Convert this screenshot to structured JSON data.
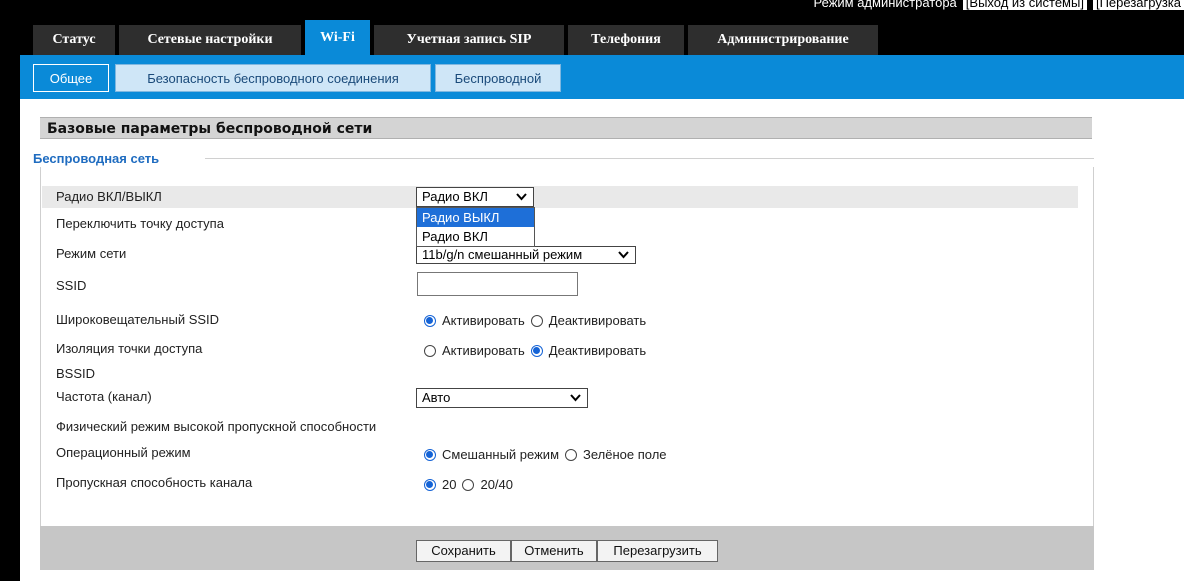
{
  "topbar": {
    "mode": "Режим администратора",
    "logout": "[Выход из системы]",
    "reboot": "[Перезагрузка"
  },
  "tabs": [
    "Статус",
    "Сетевые настройки",
    "Wi-Fi",
    "Учетная запись SIP",
    "Телефония",
    "Администрирование"
  ],
  "active_tab": "Wi-Fi",
  "subtabs": [
    "Общее",
    "Безопасность беспроводного соединения",
    "Беспроводной"
  ],
  "active_subtab": "Общее",
  "section_title": "Базовые параметры беспроводной сети",
  "legend": "Беспроводная сеть",
  "fields": {
    "radio": {
      "label": "Радио ВКЛ/ВЫКЛ",
      "value": "Радио ВКЛ",
      "options": [
        "Радио ВЫКЛ",
        "Радио ВКЛ"
      ],
      "highlighted_option": "Радио ВЫКЛ"
    },
    "ap_switch": {
      "label": "Переключить точку доступа"
    },
    "net_mode": {
      "label": "Режим сети",
      "value": "11b/g/n смешанный режим"
    },
    "ssid": {
      "label": "SSID",
      "value": ""
    },
    "broadcast_ssid": {
      "label": "Широковещательный SSID",
      "options": [
        "Активировать",
        "Деактивировать"
      ],
      "selected": "Активировать"
    },
    "ap_isolation": {
      "label": "Изоляция точки доступа",
      "options": [
        "Активировать",
        "Деактивировать"
      ],
      "selected": "Деактивировать"
    },
    "bssid": {
      "label": "BSSID"
    },
    "channel": {
      "label": "Частота (канал)",
      "value": "Авто"
    },
    "ht_phy": {
      "label": "Физический режим высокой пропускной способности"
    },
    "op_mode": {
      "label": "Операционный режим",
      "options": [
        "Смешанный режим",
        "Зелёное поле"
      ],
      "selected": "Смешанный режим"
    },
    "bandwidth": {
      "label": "Пропускная способность канала",
      "options": [
        "20",
        "20/40"
      ],
      "selected": "20"
    }
  },
  "buttons": {
    "save": "Сохранить",
    "cancel": "Отменить",
    "reboot": "Перезагрузить"
  },
  "colors": {
    "accent": "#0a8ad8",
    "legend": "#1f6cc0",
    "dropdown_highlight": "#1e6fd8"
  }
}
